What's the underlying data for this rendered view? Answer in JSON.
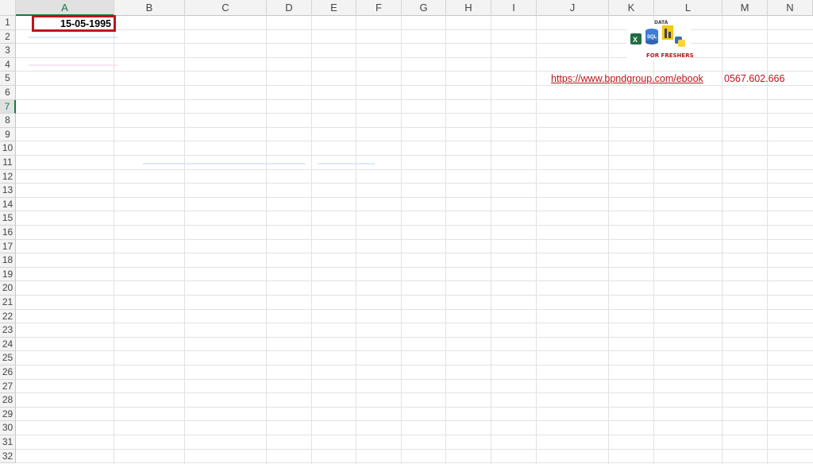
{
  "columns": [
    "A",
    "B",
    "C",
    "D",
    "E",
    "F",
    "G",
    "H",
    "I",
    "J",
    "K",
    "L",
    "M",
    "N"
  ],
  "rows": [
    "1",
    "2",
    "3",
    "4",
    "5",
    "6",
    "7",
    "8",
    "9",
    "10",
    "11",
    "12",
    "13",
    "14",
    "15",
    "16",
    "17",
    "18",
    "19",
    "20",
    "21",
    "22",
    "23",
    "24",
    "25",
    "26",
    "27",
    "28",
    "29",
    "30",
    "31",
    "32"
  ],
  "active_column": "A",
  "active_row": "7",
  "cells": {
    "a1": "15-05-1995",
    "j5": "https://www.bpndgroup.com/ebook",
    "m5": "0567.602.666"
  },
  "logo": {
    "top_text": "DATA",
    "caption": "FOR FRESHERS",
    "icons": [
      "sql-icon",
      "excel-icon",
      "powerbi-icon",
      "python-icon"
    ]
  },
  "colors": {
    "highlight_border": "#c0141a",
    "link": "#c0141a",
    "header_bg": "#f3f3f3",
    "gridline": "#e2e2e2"
  }
}
